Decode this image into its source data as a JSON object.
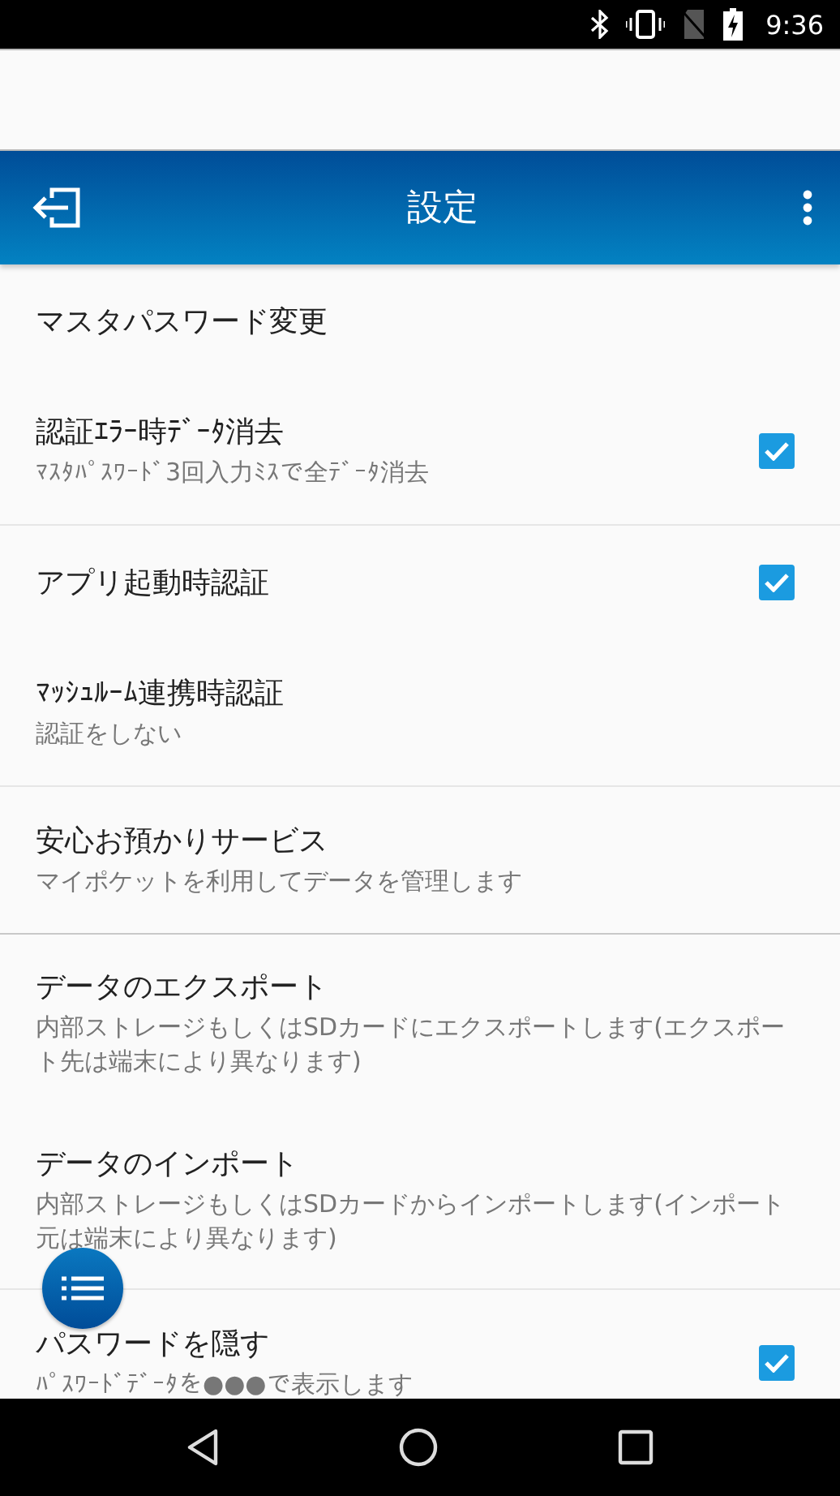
{
  "status_bar": {
    "time": "9:36"
  },
  "app_bar": {
    "title": "設定"
  },
  "sections": [
    {
      "items": [
        {
          "kind": "plain",
          "title": "マスタパスワード変更"
        },
        {
          "kind": "checkbox",
          "title": "認証ｴﾗｰ時ﾃﾞｰﾀ消去",
          "subtitle": "ﾏｽﾀﾊﾟｽﾜｰﾄﾞ3回入力ﾐｽで全ﾃﾞｰﾀ消去",
          "checked": true
        }
      ]
    },
    {
      "items": [
        {
          "kind": "checkbox",
          "title": "アプリ起動時認証",
          "checked": true
        },
        {
          "kind": "plain",
          "title": "ﾏｯｼｭﾙｰﾑ連携時認証",
          "subtitle": "認証をしない"
        }
      ]
    },
    {
      "items": [
        {
          "kind": "plain",
          "title": "安心お預かりサービス",
          "subtitle": "マイポケットを利用してデータを管理します"
        }
      ]
    },
    {
      "items": [
        {
          "kind": "plain",
          "title": "データのエクスポート",
          "subtitle": "内部ストレージもしくはSDカードにエクスポートします(エクスポート先は端末により異なります)"
        },
        {
          "kind": "plain",
          "title": "データのインポート",
          "subtitle": "内部ストレージもしくはSDカードからインポートします(インポート元は端末により異なります)"
        }
      ]
    },
    {
      "items": [
        {
          "kind": "checkbox",
          "title": "パスワードを隠す",
          "subtitle": "ﾊﾟｽﾜｰﾄﾞﾃﾞｰﾀを●●●で表示します",
          "checked": true
        }
      ]
    }
  ]
}
